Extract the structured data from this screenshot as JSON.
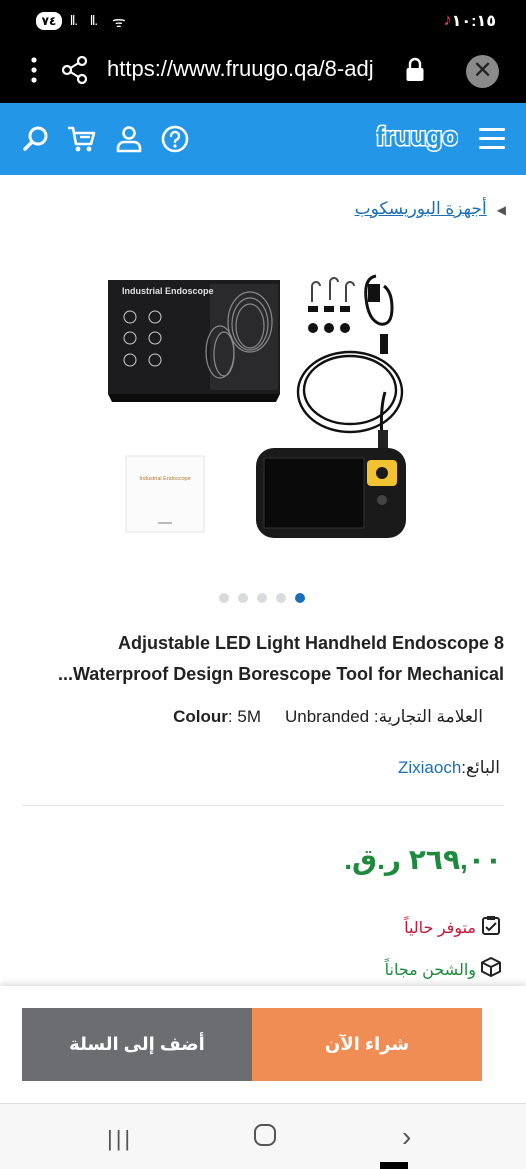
{
  "status_bar": {
    "battery": "٧٤",
    "signal1": "ll.",
    "signal2": "ll.",
    "wifi": "ᯤ",
    "tiktok_glyph": "♪",
    "time": "١٠:١٥"
  },
  "browser": {
    "url": "https://www.fruugo.qa/8-adj",
    "close_glyph": "✕"
  },
  "header": {
    "logo_text": "fruugo",
    "accent_color": "#2396e8"
  },
  "breadcrumb": {
    "arrow": "◀",
    "label": "أجهزة البوريسكوب"
  },
  "product_image": {
    "box_label": "Industrial Endoscope",
    "manual_label": "Industrial Endoscope"
  },
  "carousel": {
    "count": 5,
    "active_index": 4
  },
  "product": {
    "title_line1": "Adjustable LED Light Handheld Endoscope 8",
    "title_line2": "...Waterproof Design Borescope Tool for Mechanical",
    "brand_label": "العلامة التجارية:",
    "brand_value": "Unbranded",
    "colour_label": "Colour",
    "colour_value": ": 5M",
    "seller_label": "البائع:",
    "seller_value": "Zixiaoch",
    "price": "٢٦٩,٠٠ ر.ق.",
    "stock": "متوفر حالياً",
    "shipping": "والشحن مجاناً"
  },
  "actions": {
    "add_to_cart": "أضف إلى السلة",
    "buy_now": "شراء الآن",
    "buy_color": "#ef8d54",
    "cart_color": "#6b6d70"
  },
  "android_nav": {
    "recent": "|||",
    "back": "›"
  }
}
